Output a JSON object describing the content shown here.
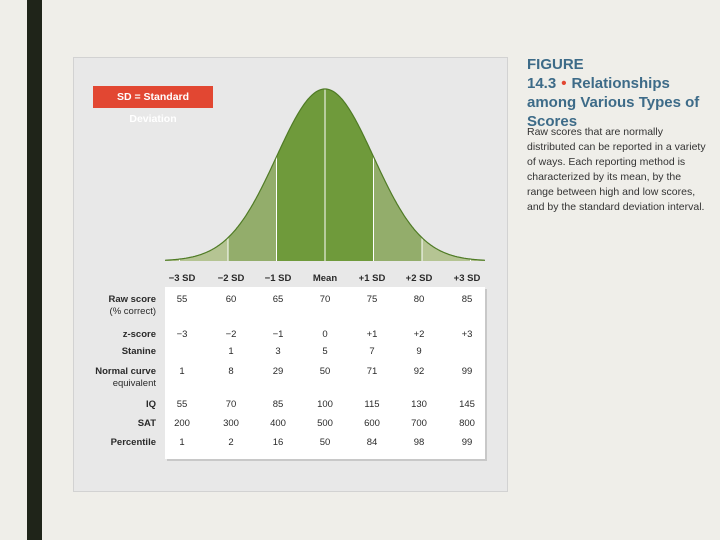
{
  "badge": "SD = Standard Deviation",
  "caption": {
    "figure_label": "FIGURE 14.3",
    "separator": "•",
    "title": "Relationships among Various Types of Scores",
    "body": "Raw scores that are normally distributed can be reported in a variety of ways. Each reporting method is characterized by its mean, by the range between high and low scores, and by the standard deviation interval."
  },
  "colors": {
    "curve_inner": "#6f9a3b",
    "curve_middle": "#93ad6b",
    "curve_outer": "#b5c493",
    "badge_red": "#e24732",
    "caption_blue": "#3d6b88"
  },
  "columns": [
    "−3 SD",
    "−2 SD",
    "−1 SD",
    "Mean",
    "+1 SD",
    "+2 SD",
    "+3 SD"
  ],
  "rows": [
    {
      "label": [
        "Raw score",
        "(% correct)"
      ],
      "values": [
        "55",
        "60",
        "65",
        "70",
        "75",
        "80",
        "85"
      ]
    },
    {
      "label": [
        "z-score"
      ],
      "values": [
        "−3",
        "−2",
        "−1",
        "0",
        "+1",
        "+2",
        "+3"
      ]
    },
    {
      "label": [
        "Stanine"
      ],
      "values": [
        "",
        "1",
        "3",
        "5",
        "7",
        "9",
        ""
      ]
    },
    {
      "label": [
        "Normal curve",
        "equivalent"
      ],
      "values": [
        "1",
        "8",
        "29",
        "50",
        "71",
        "92",
        "99"
      ]
    },
    {
      "label": [
        "IQ"
      ],
      "values": [
        "55",
        "70",
        "85",
        "100",
        "115",
        "130",
        "145"
      ]
    },
    {
      "label": [
        "SAT"
      ],
      "values": [
        "200",
        "300",
        "400",
        "500",
        "600",
        "700",
        "800"
      ]
    },
    {
      "label": [
        "Percentile"
      ],
      "values": [
        "1",
        "2",
        "16",
        "50",
        "84",
        "98",
        "99"
      ]
    }
  ]
}
